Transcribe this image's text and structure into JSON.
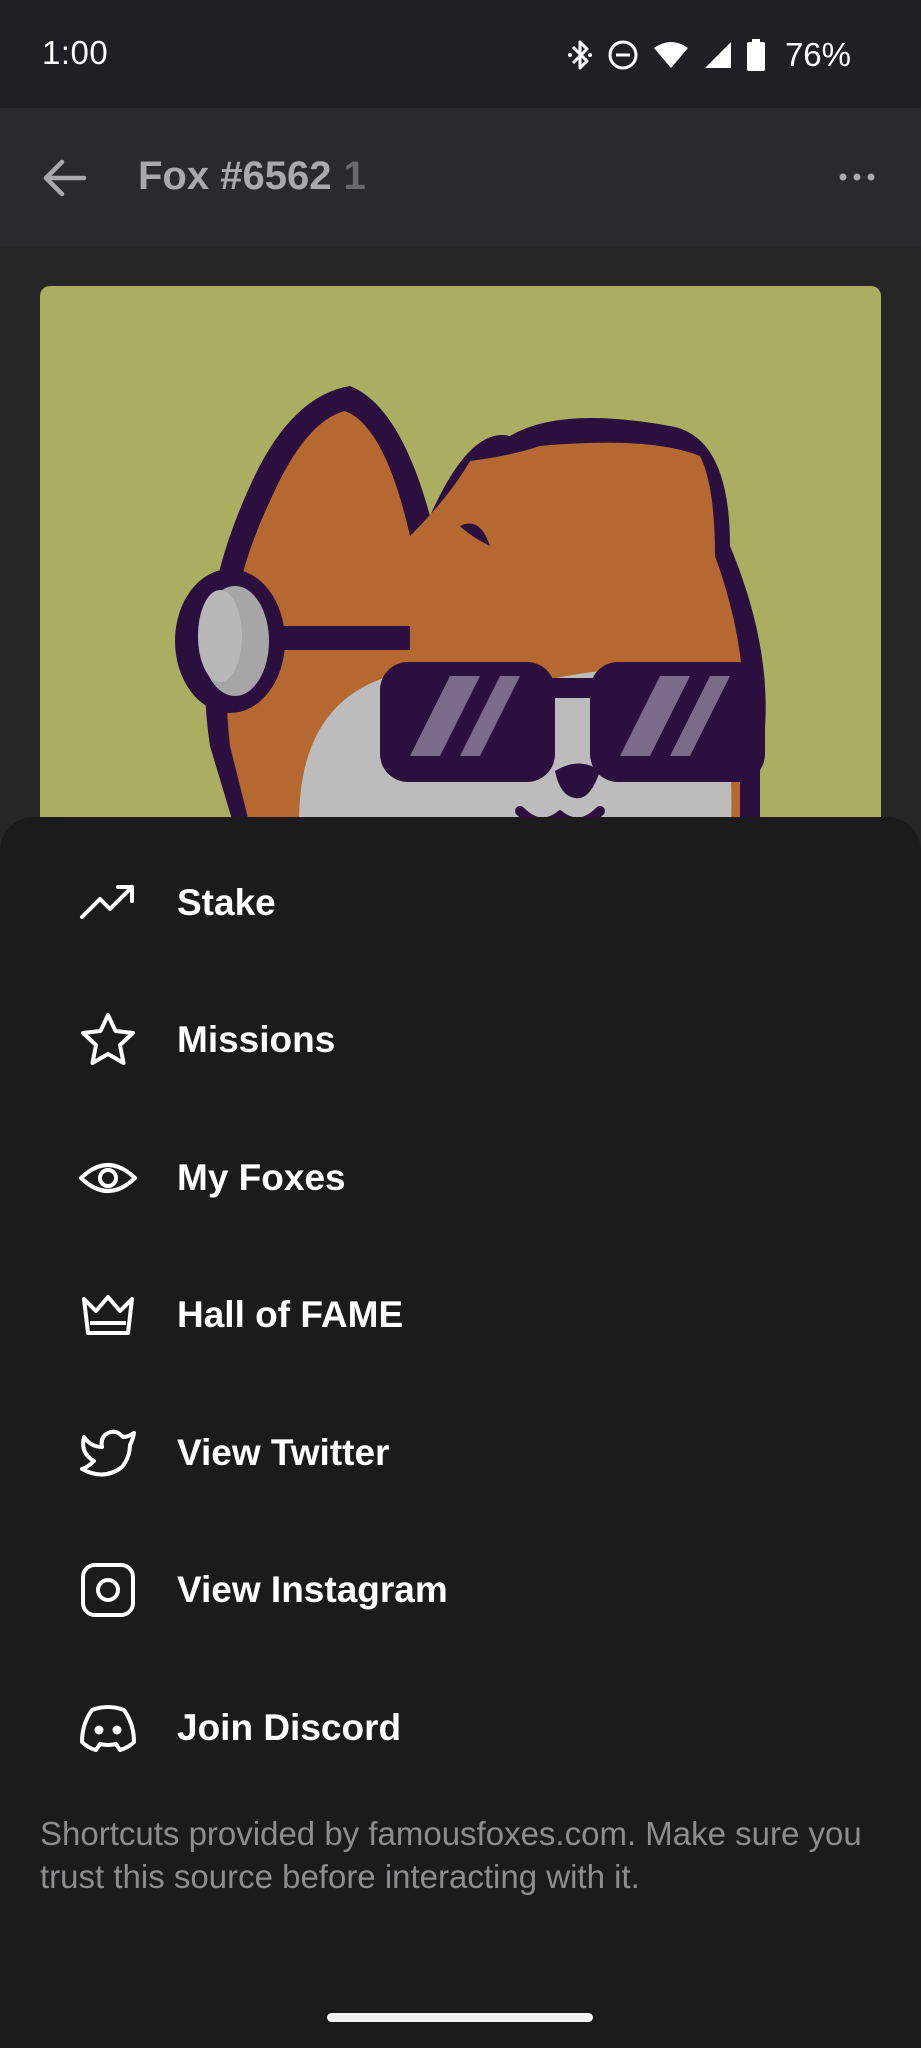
{
  "status_bar": {
    "time": "1:00",
    "battery": "76%",
    "icons": [
      "bluetooth-icon",
      "do-not-disturb-icon",
      "wifi-icon",
      "signal-icon",
      "battery-icon"
    ]
  },
  "header": {
    "title": "Fox #6562",
    "count": "1"
  },
  "nft": {
    "background_color": "#abad61"
  },
  "menu": {
    "items": [
      {
        "label": "Stake",
        "icon": "trending-up-icon"
      },
      {
        "label": "Missions",
        "icon": "star-icon"
      },
      {
        "label": "My Foxes",
        "icon": "eye-icon"
      },
      {
        "label": "Hall of FAME",
        "icon": "crown-icon"
      },
      {
        "label": "View Twitter",
        "icon": "twitter-icon"
      },
      {
        "label": "View Instagram",
        "icon": "instagram-icon"
      },
      {
        "label": "Join Discord",
        "icon": "discord-icon"
      }
    ],
    "footer": "Shortcuts provided by famousfoxes.com. Make sure you trust this source before interacting with it."
  },
  "colors": {
    "sheet_background": "#1b1b1b",
    "status_bar": "#1f2023",
    "text_primary": "#ffffff",
    "text_secondary": "#8d8d8f"
  }
}
